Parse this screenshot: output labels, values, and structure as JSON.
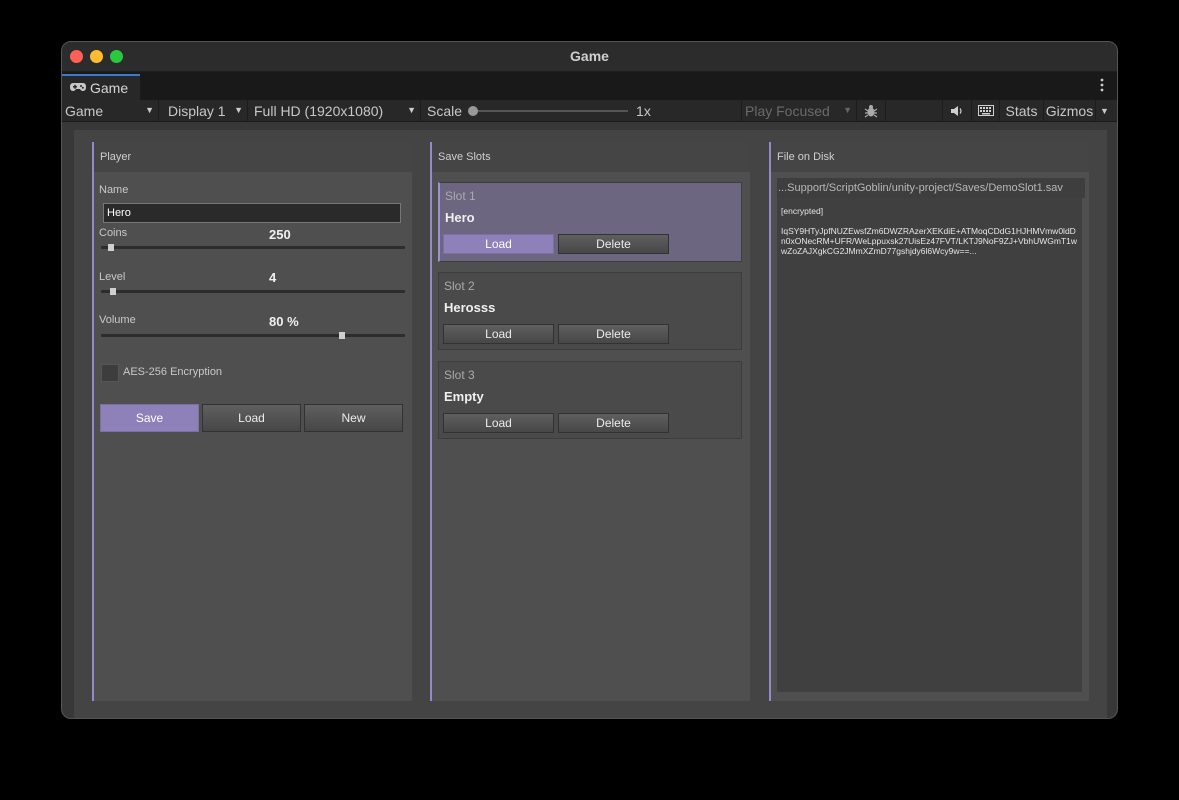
{
  "window": {
    "title": "Game"
  },
  "tab": {
    "label": "Game"
  },
  "toolbar": {
    "view_mode": "Game",
    "display": "Display 1",
    "resolution": "Full HD (1920x1080)",
    "scale_label": "Scale",
    "scale_value": "1x",
    "play_mode": "Play Focused",
    "stats": "Stats",
    "gizmos": "Gizmos"
  },
  "player_panel": {
    "header": "Player",
    "name_label": "Name",
    "name_value": "Hero",
    "coins_label": "Coins",
    "coins_value": "250",
    "level_label": "Level",
    "level_value": "4",
    "volume_label": "Volume",
    "volume_value": "80 %",
    "encryption_label": "AES-256 Encryption",
    "encryption_checked": false,
    "save_button": "Save",
    "load_button": "Load",
    "new_button": "New"
  },
  "slots_panel": {
    "header": "Save Slots",
    "slots": [
      {
        "name": "Slot 1",
        "player": "Hero",
        "load": "Load",
        "delete": "Delete"
      },
      {
        "name": "Slot 2",
        "player": "Herosss",
        "load": "Load",
        "delete": "Delete"
      },
      {
        "name": "Slot 3",
        "player": "Empty",
        "load": "Load",
        "delete": "Delete"
      }
    ]
  },
  "file_panel": {
    "header": "File on Disk",
    "path": "...Support/ScriptGoblin/unity-project/Saves/DemoSlot1.sav",
    "tag": "[encrypted]",
    "content": "IqSY9HTyJpfNUZEwsfZm6DWZRAzerXEKdiE+ATMoqCDdG1HJHMVmw0ldDn0xONecRM+UFR/WeLppuxsk27UisEz47FVT/LKTJ9NoF9ZJ+VbhUWGmT1wwZoZAJXgkCG2JMmXZmD77gshjdy6l6Wcy9w==..."
  },
  "colors": {
    "accent": "#9688c9",
    "primary_button": "#8e80b8",
    "active_slot": "#6c6680"
  },
  "icons": {
    "tab": "gamepad-icon",
    "bug": "bug-icon",
    "audio": "speaker-icon",
    "keyboard": "keyboard-icon",
    "menu": "kebab-menu-icon"
  }
}
